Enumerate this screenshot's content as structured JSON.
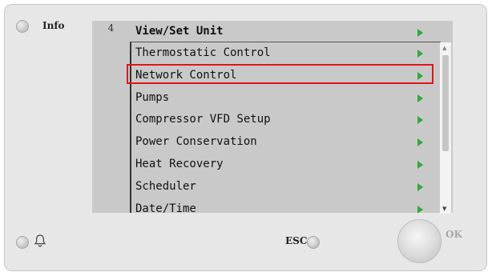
{
  "left_panel": {
    "info_label": "Info"
  },
  "screen": {
    "page_number": "4",
    "header": "View/Set Unit",
    "selected_index": 1,
    "items": [
      {
        "label": "Thermostatic Control"
      },
      {
        "label": "Network Control"
      },
      {
        "label": "Pumps"
      },
      {
        "label": "Compressor VFD Setup"
      },
      {
        "label": "Power Conservation"
      },
      {
        "label": "Heat Recovery"
      },
      {
        "label": "Scheduler"
      },
      {
        "label": "Date/Time"
      }
    ]
  },
  "bottom_panel": {
    "esc_label": "ESC",
    "ok_label": "OK"
  },
  "colors": {
    "arrow": "#2faa3a",
    "highlight": "#e0161b",
    "screen_bg": "#c9c9c9"
  },
  "icons": {
    "bell": "bell-icon",
    "scroll_up": "scroll-up-icon",
    "scroll_down": "scroll-down-icon",
    "arrow": "arrow-right-icon"
  }
}
